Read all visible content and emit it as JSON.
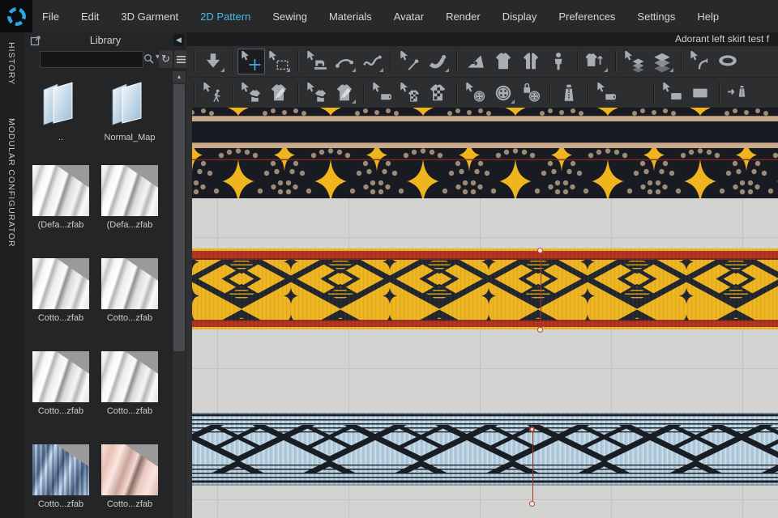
{
  "window": {
    "document_title": "Adorant left skirt test f"
  },
  "menubar": {
    "logo": "CLO",
    "items": [
      {
        "label": "File"
      },
      {
        "label": "Edit"
      },
      {
        "label": "3D Garment"
      },
      {
        "label": "2D Pattern",
        "active": true
      },
      {
        "label": "Sewing"
      },
      {
        "label": "Materials"
      },
      {
        "label": "Avatar"
      },
      {
        "label": "Render"
      },
      {
        "label": "Display"
      },
      {
        "label": "Preferences"
      },
      {
        "label": "Settings"
      },
      {
        "label": "Help"
      }
    ]
  },
  "side_tabs": {
    "items": [
      {
        "label": "HISTORY"
      },
      {
        "label": "MODULAR CONFIGURATOR"
      }
    ]
  },
  "library": {
    "title": "Library",
    "search": {
      "value": "",
      "placeholder": ""
    },
    "header_icons": [
      "popout-icon",
      "collapse-arrow-icon"
    ],
    "toolbar_icons": [
      "search-icon",
      "dropdown-caret-icon",
      "refresh-icon",
      "list-view-icon"
    ],
    "items": [
      {
        "label": "..",
        "type": "folder"
      },
      {
        "label": "Normal_Map",
        "type": "folder"
      },
      {
        "label": "(Defa...zfab",
        "type": "fabric-white"
      },
      {
        "label": "(Defa...zfab",
        "type": "fabric-white"
      },
      {
        "label": "Cotto...zfab",
        "type": "fabric-white"
      },
      {
        "label": "Cotto...zfab",
        "type": "fabric-white"
      },
      {
        "label": "Cotto...zfab",
        "type": "fabric-white"
      },
      {
        "label": "Cotto...zfab",
        "type": "fabric-white"
      },
      {
        "label": "Cotto...zfab",
        "type": "fabric-blue"
      },
      {
        "label": "Cotto...zfab",
        "type": "fabric-pink"
      }
    ]
  },
  "toolbar": {
    "row1": [
      {
        "type": "sep"
      },
      {
        "name": "import-export",
        "icon": "import-down",
        "sub": true
      },
      {
        "type": "sep"
      },
      {
        "name": "transform-pattern",
        "icon": "transform",
        "active": true
      },
      {
        "name": "edit-pattern-marquee",
        "icon": "edit-marquee",
        "sub": true
      },
      {
        "type": "sep"
      },
      {
        "name": "sewing-machine",
        "icon": "sew-machine"
      },
      {
        "name": "segment-sewing",
        "icon": "segment-sew",
        "sub": true
      },
      {
        "name": "free-sewing",
        "icon": "free-sew",
        "sub": true
      },
      {
        "type": "sep"
      },
      {
        "name": "pin-tool",
        "icon": "pin"
      },
      {
        "name": "tack-tool",
        "icon": "tack",
        "sub": true
      },
      {
        "type": "sep"
      },
      {
        "name": "unfold-tool",
        "icon": "unfold"
      },
      {
        "name": "arrange-panels",
        "icon": "shirt"
      },
      {
        "name": "split-panel",
        "icon": "shirt-split"
      },
      {
        "name": "avatar-arrangement",
        "icon": "person"
      },
      {
        "type": "sep"
      },
      {
        "name": "reset-2d-arrangement",
        "icon": "garment-up",
        "sub": true
      },
      {
        "type": "sep"
      },
      {
        "name": "flatten-select",
        "icon": "flatten-cur"
      },
      {
        "name": "flatten-tool",
        "icon": "flatten",
        "sub": true
      },
      {
        "type": "sep"
      },
      {
        "name": "edit-measure",
        "icon": "measure"
      },
      {
        "name": "tape-measure",
        "icon": "ring"
      }
    ],
    "row2": [
      {
        "type": "sep"
      },
      {
        "name": "walkthrough",
        "icon": "walk"
      },
      {
        "type": "sep"
      },
      {
        "name": "edit-sewing",
        "icon": "shirt-curve"
      },
      {
        "name": "edit-seam",
        "icon": "shirt-pen"
      },
      {
        "type": "sep"
      },
      {
        "name": "edit-puckering",
        "icon": "shirt-wave"
      },
      {
        "name": "seam-taping",
        "icon": "shirt-pencil",
        "sub": true
      },
      {
        "type": "sep"
      },
      {
        "name": "edit-texture",
        "icon": "roll-cur"
      },
      {
        "name": "adjust-pattern",
        "icon": "check-shirt-cur"
      },
      {
        "name": "pattern-print",
        "icon": "check-shirt"
      },
      {
        "type": "sep"
      },
      {
        "name": "select-button",
        "icon": "button-cur"
      },
      {
        "name": "attach-button",
        "icon": "button",
        "sub": true
      },
      {
        "name": "attach-buttonhole",
        "icon": "button-lock"
      },
      {
        "type": "sep"
      },
      {
        "name": "zipper",
        "icon": "zipper"
      },
      {
        "type": "sep"
      },
      {
        "name": "edit-trim",
        "icon": "roll-cur"
      },
      {
        "name": "attach-trim",
        "icon": "roll"
      },
      {
        "type": "sep"
      },
      {
        "name": "edit-grading",
        "icon": "swatch-cur"
      },
      {
        "name": "grading",
        "icon": "swatch"
      },
      {
        "type": "sep"
      },
      {
        "name": "zipper-clipped",
        "icon": "arrow-zip"
      }
    ]
  },
  "colors": {
    "accent_blue": "#4db7e6",
    "canvas_gray": "#d3d4d2",
    "band_yellow": "#edb420",
    "band_red": "#b23220",
    "band_black": "#1a1d23",
    "band_tan": "#c9aa8c",
    "band_blue": "#b8cfdf",
    "dot_tan": "#9c8a77",
    "marker_red": "#c0453c"
  }
}
